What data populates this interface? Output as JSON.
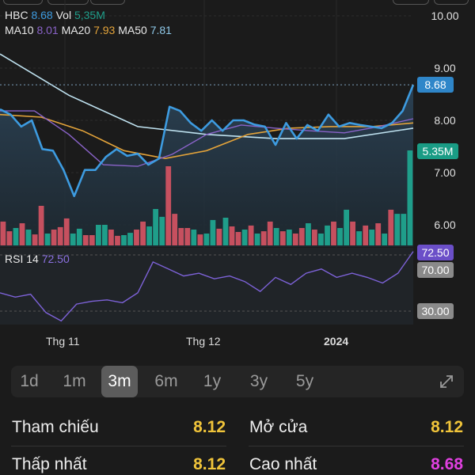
{
  "header": {
    "symbol": "HBC",
    "price": "8.68",
    "vol_label": "Vol",
    "vol": "5,35M",
    "ma10_label": "MA10",
    "ma10": "8.01",
    "ma20_label": "MA20",
    "ma20": "7.93",
    "ma50_label": "MA50",
    "ma50": "7.81",
    "rsi_label": "RSI 14",
    "rsi": "72.50"
  },
  "colors": {
    "price": "#3d9be0",
    "ma10": "#8a63c9",
    "ma20": "#e3a33a",
    "ma50": "#bfe2f0",
    "up": "#1f9e8a",
    "down": "#c6505f",
    "rsi": "#7d62d8",
    "yellow": "#f0c43a",
    "magenta": "#e040e0"
  },
  "axis": {
    "price_ticks": [
      "10.00",
      "9.00",
      "8.00",
      "7.00",
      "6.00"
    ],
    "price_tick_values": [
      10,
      9,
      8,
      7,
      6
    ],
    "last_price_tag": "8.68",
    "volume_tag": "5.35M",
    "rsi_tag": "72.50",
    "rsi_upper_tag": "70.00",
    "rsi_lower_tag": "30.00",
    "months": [
      "Thg 11",
      "Thg 12",
      "2024"
    ]
  },
  "chart_data": {
    "type": "line",
    "price": [
      8.21,
      8.11,
      7.88,
      8.0,
      7.45,
      7.42,
      7.05,
      6.55,
      7.05,
      7.05,
      7.3,
      7.45,
      7.32,
      7.36,
      7.15,
      7.27,
      8.26,
      8.18,
      7.95,
      7.8,
      8.0,
      7.8,
      8.0,
      8.0,
      7.92,
      7.88,
      7.53,
      7.95,
      7.65,
      7.91,
      7.8,
      8.11,
      7.88,
      7.95,
      7.91,
      7.88,
      7.85,
      7.95,
      8.18,
      8.68
    ],
    "ma10": [
      8.18,
      8.18,
      7.73,
      7.15,
      7.12,
      7.35,
      7.73,
      7.91,
      7.85,
      7.8,
      7.76,
      7.88,
      8.03
    ],
    "ma20": [
      8.11,
      8.06,
      7.8,
      7.42,
      7.27,
      7.42,
      7.73,
      7.85,
      7.88,
      7.88,
      7.95
    ],
    "ma50": [
      9.27,
      8.48,
      7.88,
      7.73,
      7.65,
      7.65,
      7.85
    ],
    "volume_m": [
      1.34,
      0.8,
      0.98,
      1.25,
      0.89,
      0.62,
      2.23,
      0.67,
      0.89,
      1.03,
      1.52,
      0.67,
      0.94,
      0.58,
      0.58,
      1.16,
      1.16,
      0.89,
      0.54,
      0.58,
      0.71,
      0.89,
      1.34,
      1.07,
      2.05,
      1.61,
      4.46,
      1.78,
      0.98,
      0.98,
      0.89,
      0.62,
      0.67,
      1.43,
      0.94,
      1.56,
      1.07,
      0.76,
      0.89,
      1.12,
      0.67,
      0.8,
      1.34,
      0.98,
      0.8,
      0.89,
      0.67,
      0.98,
      1.25,
      0.89,
      0.67,
      1.12,
      1.34,
      0.98,
      2.01,
      1.34,
      0.8,
      1.12,
      0.89,
      1.25,
      0.67,
      2.01,
      1.78,
      1.78,
      5.35
    ],
    "volume_up": [
      0,
      0,
      1,
      0,
      1,
      0,
      0,
      1,
      0,
      0,
      0,
      1,
      1,
      0,
      0,
      1,
      1,
      0,
      0,
      1,
      1,
      0,
      0,
      1,
      1,
      1,
      0,
      0,
      0,
      0,
      1,
      0,
      1,
      1,
      0,
      1,
      0,
      0,
      1,
      0,
      1,
      0,
      0,
      1,
      0,
      1,
      0,
      0,
      1,
      0,
      1,
      1,
      0,
      1,
      1,
      0,
      1,
      0,
      1,
      0,
      1,
      0,
      1,
      1,
      1
    ],
    "rsi": [
      43,
      40,
      42,
      29,
      23,
      35,
      37,
      38,
      36,
      43,
      65,
      60,
      55,
      57,
      53,
      55,
      51,
      44,
      54,
      49,
      57,
      60,
      54,
      57,
      54,
      50,
      57,
      72.5
    ],
    "price_range": [
      5.6,
      10.3
    ],
    "rsi_levels": [
      70,
      30
    ]
  },
  "timeframes": {
    "items": [
      "1d",
      "1m",
      "3m",
      "6m",
      "1y",
      "3y",
      "5y"
    ],
    "selected": "3m"
  },
  "stats": {
    "ref_label": "Tham chiếu",
    "ref": "8.12",
    "open_label": "Mở cửa",
    "open": "8.12",
    "low_label": "Thấp nhất",
    "low": "8.12",
    "high_label": "Cao nhất",
    "high": "8.68"
  }
}
